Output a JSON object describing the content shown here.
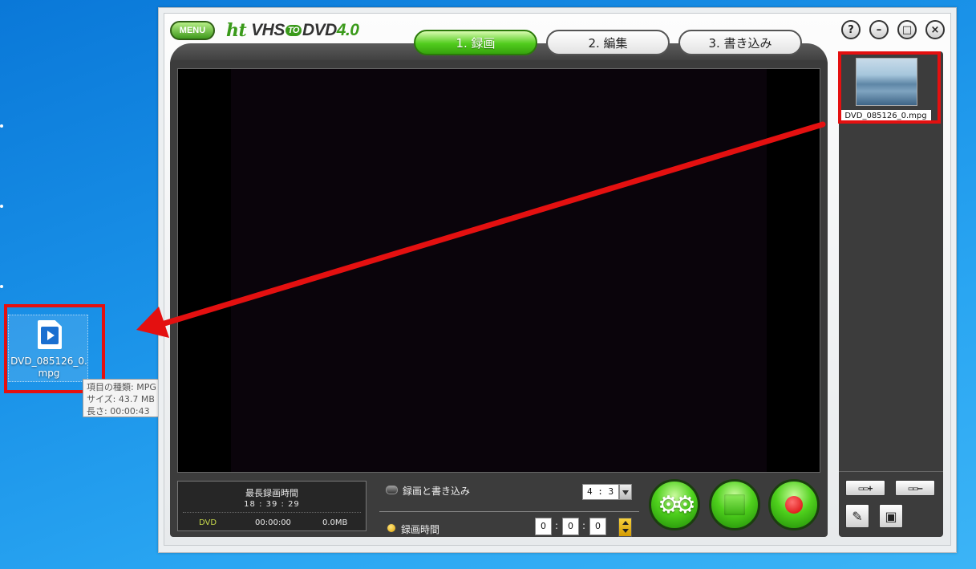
{
  "desktop": {
    "file_label": "DVD_085126_0.mpg",
    "tooltip": {
      "type_line": "項目の種類: MPG ファイル",
      "size_line": "サイズ: 43.7 MB",
      "length_line": "長さ: 00:00:43"
    }
  },
  "app": {
    "menu_label": "MENU",
    "logo": {
      "ht": "ht",
      "vhs": "VHS",
      "to": "TO",
      "dvd": "DVD",
      "version": "4.0"
    },
    "tabs": [
      {
        "label": "1. 録画",
        "active": true
      },
      {
        "label": "2. 編集",
        "active": false
      },
      {
        "label": "3. 書き込み",
        "active": false
      }
    ],
    "window_buttons": {
      "help": "?",
      "minimize": "–",
      "maximize": "□",
      "close": "×"
    },
    "info": {
      "title": "最長録画時間",
      "max_time": "18 : 39 : 29",
      "media": "DVD",
      "duration": "00:00:00",
      "size": "0.0MB"
    },
    "options": {
      "record_and_burn_label": "録画と書き込み",
      "record_time_label": "録画時間",
      "aspect_ratio": "4 : 3",
      "timer": [
        "0",
        "0",
        "0"
      ]
    },
    "side": {
      "thumbnail_label": "DVD_085126_0.mpg",
      "add_label": "▭▭+",
      "remove_label": "▭▭–",
      "edit_icon_glyph": "✎",
      "device_icon_glyph": "▣"
    }
  },
  "colors": {
    "annotation_red": "#e41010",
    "accent_green": "#3a9a1a",
    "desktop_blue": "#1a92e8"
  },
  "icons": [
    "menu-icon",
    "help-icon",
    "minimize-icon",
    "maximize-icon",
    "close-icon",
    "settings-gear-icon",
    "stop-icon",
    "record-icon",
    "add-clip-icon",
    "remove-clip-icon",
    "edit-pencil-icon",
    "device-icon",
    "video-file-icon",
    "annotation-arrow-icon"
  ]
}
